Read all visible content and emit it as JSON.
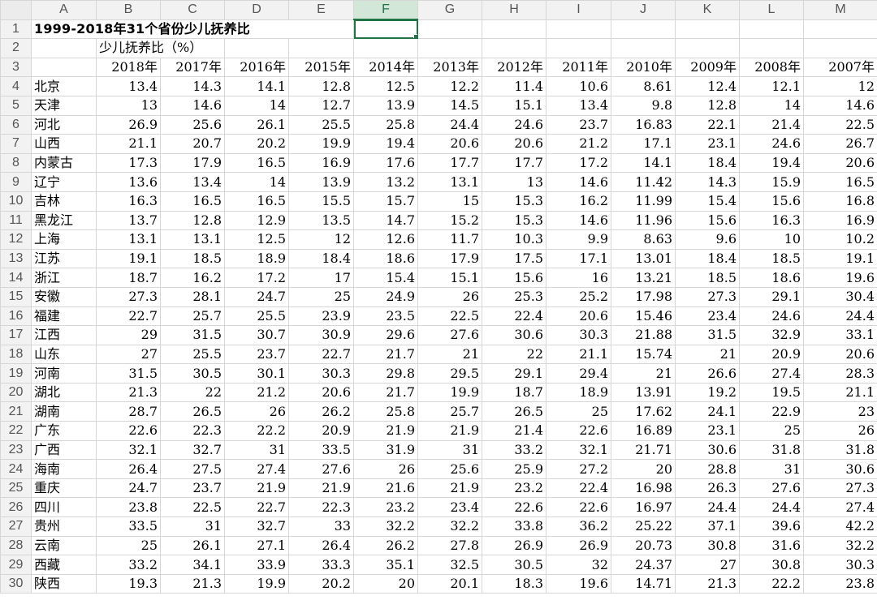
{
  "columns": [
    "A",
    "B",
    "C",
    "D",
    "E",
    "F",
    "G",
    "H",
    "I",
    "J",
    "K",
    "L",
    "M"
  ],
  "active_column": "F",
  "title": "1999-2018年31个省份少儿抚养比",
  "subtitle": "少儿抚养比（%）",
  "years": [
    "2018年",
    "2017年",
    "2016年",
    "2015年",
    "2014年",
    "2013年",
    "2012年",
    "2011年",
    "2010年",
    "2009年",
    "2008年",
    "2007年"
  ],
  "rows": [
    {
      "n": "4",
      "p": "北京",
      "v": [
        "13.4",
        "14.3",
        "14.1",
        "12.8",
        "12.5",
        "12.2",
        "11.4",
        "10.6",
        "8.61",
        "12.4",
        "12.1",
        "12"
      ]
    },
    {
      "n": "5",
      "p": "天津",
      "v": [
        "13",
        "14.6",
        "14",
        "12.7",
        "13.9",
        "14.5",
        "15.1",
        "13.4",
        "9.8",
        "12.8",
        "14",
        "14.6"
      ]
    },
    {
      "n": "6",
      "p": "河北",
      "v": [
        "26.9",
        "25.6",
        "26.1",
        "25.5",
        "25.8",
        "24.4",
        "24.6",
        "23.7",
        "16.83",
        "22.1",
        "21.4",
        "22.5"
      ]
    },
    {
      "n": "7",
      "p": "山西",
      "v": [
        "21.1",
        "20.7",
        "20.2",
        "19.9",
        "19.4",
        "20.6",
        "20.6",
        "21.2",
        "17.1",
        "23.1",
        "24.6",
        "26.7"
      ]
    },
    {
      "n": "8",
      "p": "内蒙古",
      "v": [
        "17.3",
        "17.9",
        "16.5",
        "16.9",
        "17.6",
        "17.7",
        "17.7",
        "17.2",
        "14.1",
        "18.4",
        "19.4",
        "20.6"
      ]
    },
    {
      "n": "9",
      "p": "辽宁",
      "v": [
        "13.6",
        "13.4",
        "14",
        "13.9",
        "13.2",
        "13.1",
        "13",
        "14.6",
        "11.42",
        "14.3",
        "15.9",
        "16.5"
      ]
    },
    {
      "n": "10",
      "p": "吉林",
      "v": [
        "16.3",
        "16.5",
        "16.5",
        "15.5",
        "15.7",
        "15",
        "15.3",
        "16.2",
        "11.99",
        "15.4",
        "15.6",
        "16.8"
      ]
    },
    {
      "n": "11",
      "p": "黑龙江",
      "v": [
        "13.7",
        "12.8",
        "12.9",
        "13.5",
        "14.7",
        "15.2",
        "15.3",
        "14.6",
        "11.96",
        "15.6",
        "16.3",
        "16.9"
      ]
    },
    {
      "n": "12",
      "p": "上海",
      "v": [
        "13.1",
        "13.1",
        "12.5",
        "12",
        "12.6",
        "11.7",
        "10.3",
        "9.9",
        "8.63",
        "9.6",
        "10",
        "10.2"
      ]
    },
    {
      "n": "13",
      "p": "江苏",
      "v": [
        "19.1",
        "18.5",
        "18.9",
        "18.4",
        "18.6",
        "17.9",
        "17.5",
        "17.1",
        "13.01",
        "18.4",
        "18.5",
        "19.1"
      ]
    },
    {
      "n": "14",
      "p": "浙江",
      "v": [
        "18.7",
        "16.2",
        "17.2",
        "17",
        "15.4",
        "15.1",
        "15.6",
        "16",
        "13.21",
        "18.5",
        "18.6",
        "19.6"
      ]
    },
    {
      "n": "15",
      "p": "安徽",
      "v": [
        "27.3",
        "28.1",
        "24.7",
        "25",
        "24.9",
        "26",
        "25.3",
        "25.2",
        "17.98",
        "27.3",
        "29.1",
        "30.4"
      ]
    },
    {
      "n": "16",
      "p": "福建",
      "v": [
        "22.7",
        "25.7",
        "25.5",
        "23.9",
        "23.5",
        "22.5",
        "22.4",
        "20.6",
        "15.46",
        "23.4",
        "24.6",
        "24.4"
      ]
    },
    {
      "n": "17",
      "p": "江西",
      "v": [
        "29",
        "31.5",
        "30.7",
        "30.9",
        "29.6",
        "27.6",
        "30.6",
        "30.3",
        "21.88",
        "31.5",
        "32.9",
        "33.1"
      ]
    },
    {
      "n": "18",
      "p": "山东",
      "v": [
        "27",
        "25.5",
        "23.7",
        "22.7",
        "21.7",
        "21",
        "22",
        "21.1",
        "15.74",
        "21",
        "20.9",
        "20.6"
      ]
    },
    {
      "n": "19",
      "p": "河南",
      "v": [
        "31.5",
        "30.5",
        "30.1",
        "30.3",
        "29.8",
        "29.5",
        "29.1",
        "29.4",
        "21",
        "26.6",
        "27.4",
        "28.3"
      ]
    },
    {
      "n": "20",
      "p": "湖北",
      "v": [
        "21.3",
        "22",
        "21.2",
        "20.6",
        "21.7",
        "19.9",
        "18.7",
        "18.9",
        "13.91",
        "19.2",
        "19.5",
        "21.1"
      ]
    },
    {
      "n": "21",
      "p": "湖南",
      "v": [
        "28.7",
        "26.5",
        "26",
        "26.2",
        "25.8",
        "25.7",
        "26.5",
        "25",
        "17.62",
        "24.1",
        "22.9",
        "23"
      ]
    },
    {
      "n": "22",
      "p": "广东",
      "v": [
        "22.6",
        "22.3",
        "22.2",
        "20.9",
        "21.9",
        "21.9",
        "21.4",
        "22.6",
        "16.89",
        "23.1",
        "25",
        "26"
      ]
    },
    {
      "n": "23",
      "p": "广西",
      "v": [
        "32.1",
        "32.7",
        "31",
        "33.5",
        "31.9",
        "31",
        "33.2",
        "32.1",
        "21.71",
        "30.6",
        "31.8",
        "31.8"
      ]
    },
    {
      "n": "24",
      "p": "海南",
      "v": [
        "26.4",
        "27.5",
        "27.4",
        "27.6",
        "26",
        "25.6",
        "25.9",
        "27.2",
        "20",
        "28.8",
        "31",
        "30.6"
      ]
    },
    {
      "n": "25",
      "p": "重庆",
      "v": [
        "24.7",
        "23.7",
        "21.9",
        "21.9",
        "21.6",
        "21.9",
        "23.2",
        "22.4",
        "16.98",
        "26.3",
        "27.6",
        "27.3"
      ]
    },
    {
      "n": "26",
      "p": "四川",
      "v": [
        "23.8",
        "22.5",
        "22.7",
        "22.3",
        "23.2",
        "23.4",
        "22.6",
        "22.6",
        "16.97",
        "24.4",
        "24.4",
        "27.4"
      ]
    },
    {
      "n": "27",
      "p": "贵州",
      "v": [
        "33.5",
        "31",
        "32.7",
        "33",
        "32.2",
        "32.2",
        "33.8",
        "36.2",
        "25.22",
        "37.1",
        "39.6",
        "42.2"
      ]
    },
    {
      "n": "28",
      "p": "云南",
      "v": [
        "25",
        "26.1",
        "27.1",
        "26.4",
        "26.2",
        "27.8",
        "26.9",
        "26.9",
        "20.73",
        "30.8",
        "31.6",
        "32.2"
      ]
    },
    {
      "n": "29",
      "p": "西藏",
      "v": [
        "33.2",
        "34.1",
        "33.9",
        "33.3",
        "35.1",
        "32.5",
        "30.5",
        "32",
        "24.37",
        "27",
        "30.8",
        "30.3"
      ]
    },
    {
      "n": "30",
      "p": "陕西",
      "v": [
        "19.3",
        "21.3",
        "19.9",
        "20.2",
        "20",
        "20.1",
        "18.3",
        "19.6",
        "14.71",
        "21.3",
        "22.2",
        "23.8"
      ]
    }
  ]
}
